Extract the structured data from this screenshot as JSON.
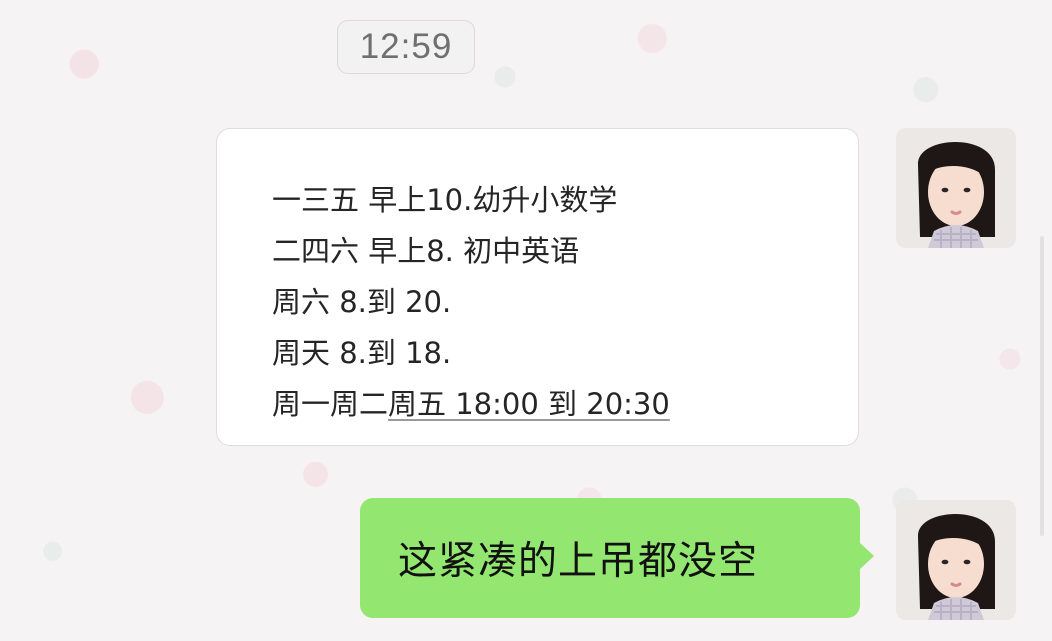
{
  "timestamp": "12:59",
  "messages": {
    "received": {
      "lines": [
        "一三五 早上10.幼升小数学",
        "二四六 早上8. 初中英语",
        "周六 8.到 20.",
        "周天 8.到 18."
      ],
      "last_line_prefix": "周一周二",
      "last_line_highlight": "周五 18:00 到 20:30"
    },
    "sent": {
      "text": "这紧凑的上吊都没空"
    }
  },
  "colors": {
    "bubble_sent": "#93e771",
    "bubble_received": "#ffffff",
    "timestamp_bg": "#f2f2f2",
    "timestamp_text": "#6f6f6f"
  },
  "icons": {
    "avatar_top": "avatar",
    "avatar_bottom": "avatar"
  }
}
